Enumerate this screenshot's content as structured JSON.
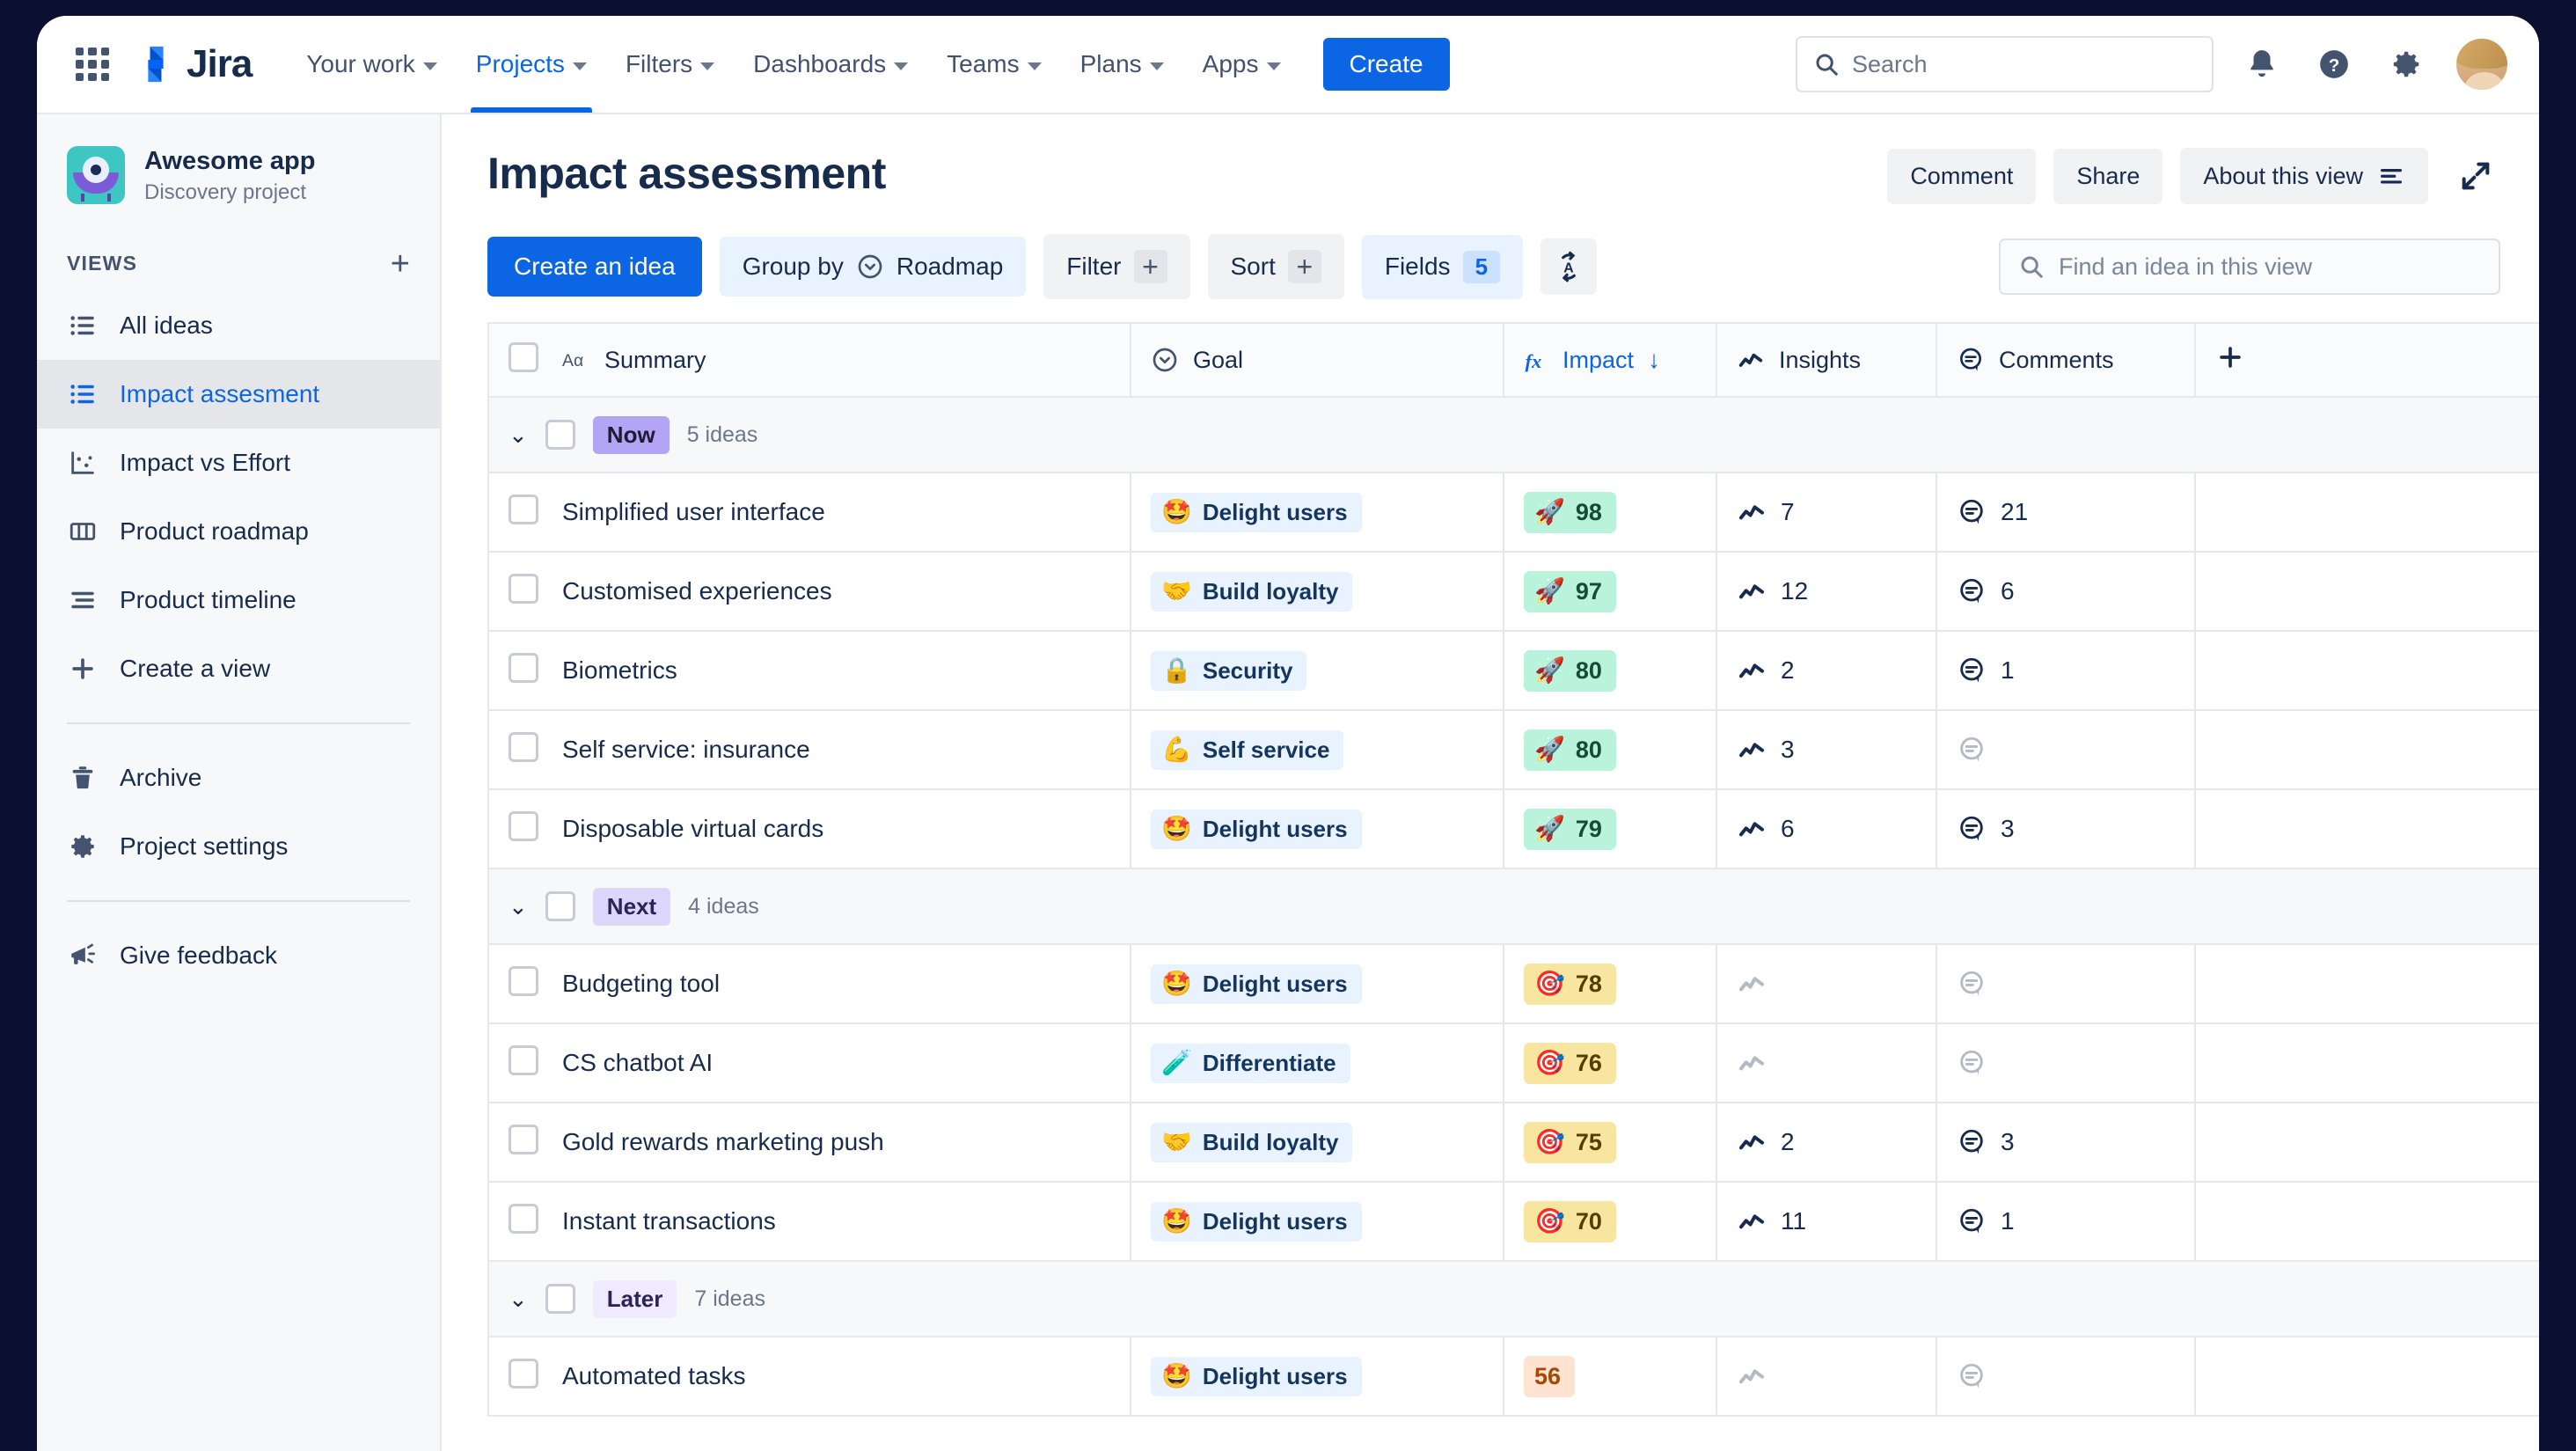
{
  "topnav": {
    "brand": "Jira",
    "waffle_label": "App switcher",
    "items": [
      {
        "label": "Your work",
        "active": false
      },
      {
        "label": "Projects",
        "active": true
      },
      {
        "label": "Filters",
        "active": false
      },
      {
        "label": "Dashboards",
        "active": false
      },
      {
        "label": "Teams",
        "active": false
      },
      {
        "label": "Plans",
        "active": false
      },
      {
        "label": "Apps",
        "active": false
      }
    ],
    "create_label": "Create",
    "search_placeholder": "Search",
    "notifications_icon": "bell-icon",
    "help_icon": "help-icon",
    "settings_icon": "gear-icon",
    "avatar_icon": "user-avatar"
  },
  "sidebar": {
    "project_name": "Awesome app",
    "project_type": "Discovery project",
    "views_title": "VIEWS",
    "add_view_label": "+",
    "views": [
      {
        "label": "All ideas",
        "icon": "list-icon",
        "active": false
      },
      {
        "label": "Impact assesment",
        "icon": "list-icon",
        "active": true
      },
      {
        "label": "Impact vs Effort",
        "icon": "scatter-chart-icon",
        "active": false
      },
      {
        "label": "Product roadmap",
        "icon": "board-columns-icon",
        "active": false
      },
      {
        "label": "Product timeline",
        "icon": "timeline-icon",
        "active": false
      },
      {
        "label": "Create a view",
        "icon": "plus-icon",
        "active": false
      }
    ],
    "secondary": [
      {
        "label": "Archive",
        "icon": "trash-icon"
      },
      {
        "label": "Project settings",
        "icon": "gear-icon"
      }
    ],
    "feedback": {
      "label": "Give feedback",
      "icon": "megaphone-icon"
    }
  },
  "header": {
    "title": "Impact assessment",
    "comment_label": "Comment",
    "share_label": "Share",
    "about_label": "About this view",
    "expand_icon": "expand-icon"
  },
  "toolbar": {
    "create_idea_label": "Create an idea",
    "group_by_label": "Group by",
    "group_by_value": "Roadmap",
    "filter_label": "Filter",
    "filter_add": "+",
    "sort_label": "Sort",
    "sort_add": "+",
    "fields_label": "Fields",
    "fields_count": "5",
    "autosort_icon": "auto-sort-icon",
    "find_placeholder": "Find an idea in this view"
  },
  "table": {
    "columns": [
      {
        "label": "Summary",
        "icon": "text-field-icon",
        "sorted": false
      },
      {
        "label": "Goal",
        "icon": "select-field-icon",
        "sorted": false
      },
      {
        "label": "Impact",
        "icon": "formula-icon",
        "sorted": true,
        "sort_dir": "↓"
      },
      {
        "label": "Insights",
        "icon": "insights-icon",
        "sorted": false
      },
      {
        "label": "Comments",
        "icon": "comment-icon",
        "sorted": false
      }
    ],
    "add_column_label": "+",
    "groups": [
      {
        "name": "Now",
        "badge_style": "now",
        "count_text": "5 ideas",
        "rows": [
          {
            "summary": "Simplified user interface",
            "goal": "Delight users",
            "goal_emoji": "🤩",
            "impact": "98",
            "impact_style": "green",
            "impact_emoji": "🚀",
            "insights": "7",
            "comments": "21"
          },
          {
            "summary": "Customised experiences",
            "goal": "Build loyalty",
            "goal_emoji": "🤝",
            "impact": "97",
            "impact_style": "green",
            "impact_emoji": "🚀",
            "insights": "12",
            "comments": "6"
          },
          {
            "summary": "Biometrics",
            "goal": "Security",
            "goal_emoji": "🔒",
            "impact": "80",
            "impact_style": "green",
            "impact_emoji": "🚀",
            "insights": "2",
            "comments": "1"
          },
          {
            "summary": "Self service: insurance",
            "goal": "Self service",
            "goal_emoji": "💪",
            "impact": "80",
            "impact_style": "green",
            "impact_emoji": "🚀",
            "insights": "3",
            "comments": ""
          },
          {
            "summary": "Disposable virtual cards",
            "goal": "Delight users",
            "goal_emoji": "🤩",
            "impact": "79",
            "impact_style": "green",
            "impact_emoji": "🚀",
            "insights": "6",
            "comments": "3"
          }
        ]
      },
      {
        "name": "Next",
        "badge_style": "next",
        "count_text": "4 ideas",
        "rows": [
          {
            "summary": "Budgeting tool",
            "goal": "Delight users",
            "goal_emoji": "🤩",
            "impact": "78",
            "impact_style": "yellow",
            "impact_emoji": "🎯",
            "insights": "",
            "comments": ""
          },
          {
            "summary": "CS chatbot AI",
            "goal": "Differentiate",
            "goal_emoji": "🧪",
            "impact": "76",
            "impact_style": "yellow",
            "impact_emoji": "🎯",
            "insights": "",
            "comments": ""
          },
          {
            "summary": "Gold rewards marketing push",
            "goal": "Build loyalty",
            "goal_emoji": "🤝",
            "impact": "75",
            "impact_style": "yellow",
            "impact_emoji": "🎯",
            "insights": "2",
            "comments": "3"
          },
          {
            "summary": "Instant transactions",
            "goal": "Delight users",
            "goal_emoji": "🤩",
            "impact": "70",
            "impact_style": "yellow",
            "impact_emoji": "🎯",
            "insights": "11",
            "comments": "1"
          }
        ]
      },
      {
        "name": "Later",
        "badge_style": "later",
        "count_text": "7 ideas",
        "rows": [
          {
            "summary": "Automated tasks",
            "goal": "Delight users",
            "goal_emoji": "🤩",
            "impact": "56",
            "impact_style": "orange",
            "impact_emoji": "",
            "insights": "",
            "comments": ""
          }
        ]
      }
    ]
  },
  "colors": {
    "brand_blue": "#0c66e4",
    "text_dark": "#172b4d",
    "text_muted": "#6b778c",
    "surface_subtle": "#f7f8f9",
    "border": "#e6e8ee",
    "badge_now": "#b3a4f5",
    "badge_next": "#ddd6fb",
    "badge_later": "#efeaff",
    "impact_green": "#baf3db",
    "impact_yellow": "#f8e6a0",
    "impact_orange": "#ffe2d0",
    "goal_chip_bg": "#e9f2ff"
  }
}
